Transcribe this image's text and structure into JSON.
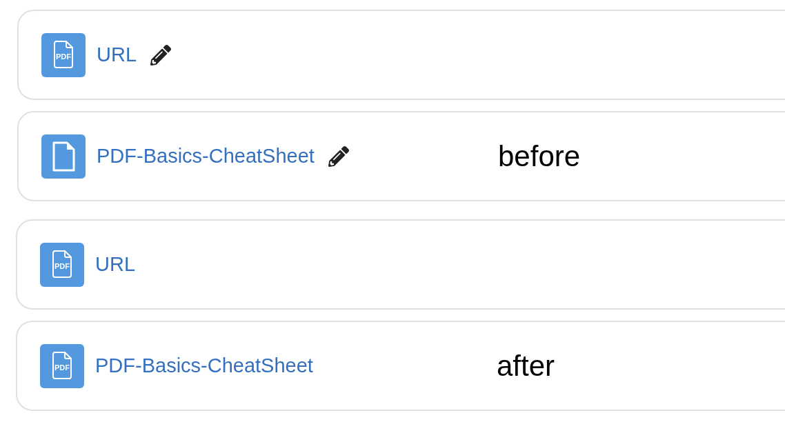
{
  "cards": [
    {
      "kind": "pdf",
      "icon_label": "PDF",
      "name": "URL",
      "editable": true
    },
    {
      "kind": "file",
      "name": "PDF-Basics-CheatSheet",
      "editable": true,
      "caption": "before"
    },
    {
      "kind": "pdf",
      "icon_label": "PDF",
      "name": "URL",
      "editable": false
    },
    {
      "kind": "pdf",
      "icon_label": "PDF",
      "name": "PDF-Basics-CheatSheet",
      "editable": false,
      "caption": "after"
    }
  ]
}
